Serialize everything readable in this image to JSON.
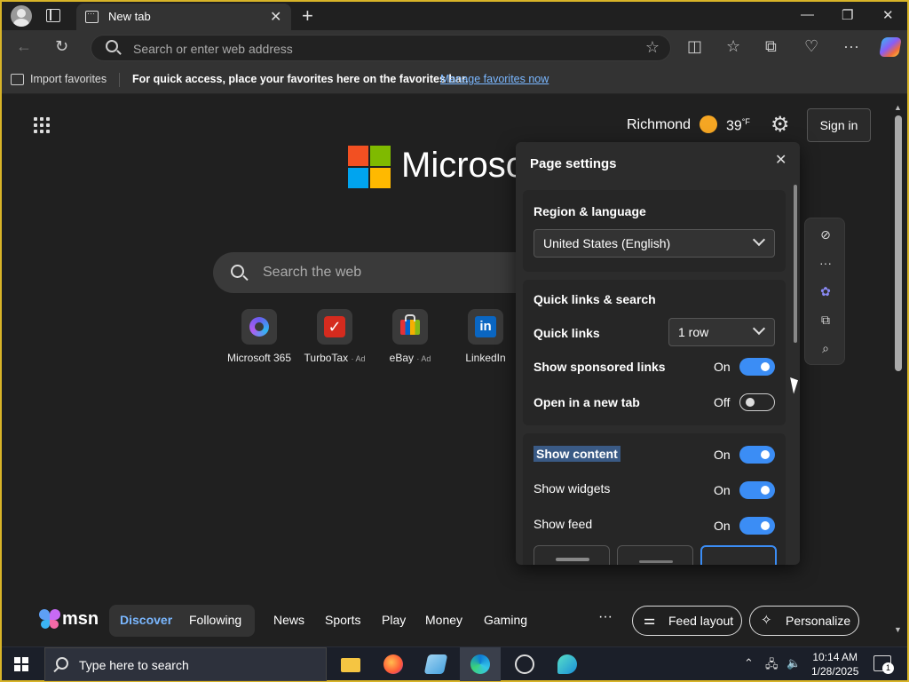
{
  "browser": {
    "tab_title": "New tab",
    "address_placeholder": "Search or enter web address"
  },
  "favorites_bar": {
    "import_label": "Import favorites",
    "message": "For quick access, place your favorites here on the favorites bar.",
    "manage_link": "Manage favorites now"
  },
  "header": {
    "city": "Richmond",
    "temperature": "39",
    "temperature_unit": "°F",
    "sign_in_label": "Sign in"
  },
  "hero": {
    "logo_text": "Microsoft",
    "search_placeholder": "Search the web"
  },
  "quick_links": [
    {
      "label": "Microsoft 365",
      "ad": ""
    },
    {
      "label": "TurboTax",
      "ad": "· Ad"
    },
    {
      "label": "eBay",
      "ad": "· Ad"
    },
    {
      "label": "LinkedIn",
      "ad": ""
    }
  ],
  "page_settings": {
    "title": "Page settings",
    "region_section": {
      "heading": "Region & language",
      "selected": "United States (English)"
    },
    "quick_links_section": {
      "heading": "Quick links & search",
      "quick_links_label": "Quick links",
      "quick_links_value": "1 row",
      "sponsored_label": "Show sponsored links",
      "sponsored_state": "On",
      "new_tab_label": "Open in a new tab",
      "new_tab_state": "Off"
    },
    "content_section": {
      "show_content_label": "Show content",
      "show_content_state": "On",
      "show_widgets_label": "Show widgets",
      "show_widgets_state": "On",
      "show_feed_label": "Show feed",
      "show_feed_state": "On"
    }
  },
  "msn_bar": {
    "logo_text": "msn",
    "tabs": [
      "Discover",
      "Following"
    ],
    "nav": [
      "News",
      "Sports",
      "Play",
      "Money",
      "Gaming"
    ],
    "more": "···",
    "feed_layout_label": "Feed layout",
    "personalize_label": "Personalize"
  },
  "taskbar": {
    "search_placeholder": "Type here to search",
    "time": "10:14 AM",
    "date": "1/28/2025",
    "notification_count": "1"
  },
  "colors": {
    "accent_blue": "#3b8df5",
    "link_blue": "#7ab7ff",
    "frame_gold": "#d8b428"
  }
}
